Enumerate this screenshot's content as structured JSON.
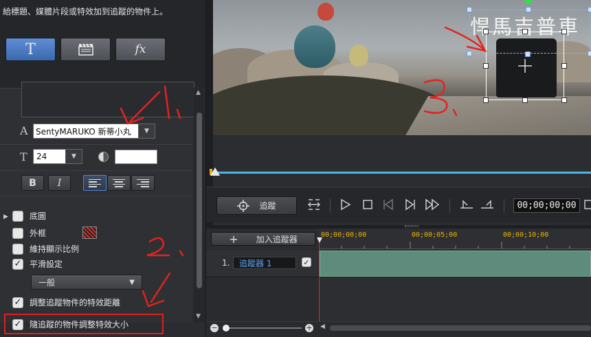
{
  "hint": "給標題、媒體片段或特效加到追蹤的物件上。",
  "modes": {
    "text_glyph": "T",
    "fx_glyph": "fx"
  },
  "text_props": {
    "font_icon": "A",
    "font_name": "SentyMARUKO 新蒂小丸",
    "size_icon": "T",
    "font_size": "24",
    "bold": "B",
    "italic": "I"
  },
  "options": {
    "background": "底圖",
    "border": "外框",
    "keep_ratio": "維持顯示比例",
    "smooth": "平滑設定",
    "smooth_level": "一般",
    "adjust_distance": "調整追蹤物件的特效距離",
    "scale_with_object": "隨追蹤的物件調整特效大小"
  },
  "preview": {
    "overlay_text": "悍馬吉普車"
  },
  "controls": {
    "track_label": "追蹤",
    "timecode": "00;00;00;00"
  },
  "timeline": {
    "add_tracker": "加入追蹤器",
    "ruler": [
      "00;00;00;00",
      "00;00;05;00",
      "00;00;10;00"
    ],
    "track_index": "1.",
    "track_name": "追蹤器 1"
  },
  "colors": {
    "accent": "#4a86d8",
    "clip": "#5e8b7c",
    "annotation_red": "#e0201e"
  }
}
